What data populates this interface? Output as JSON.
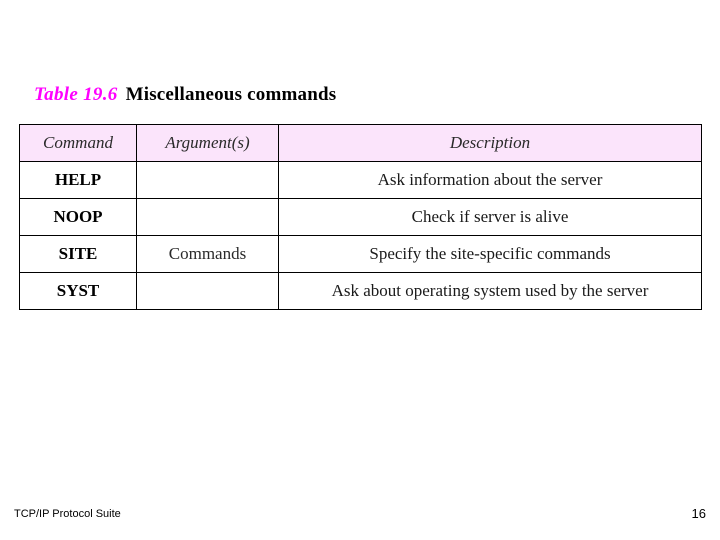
{
  "slide": {
    "title": {
      "label": "Table 19.6",
      "text": "Miscellaneous commands",
      "label_color": "#ff00ff"
    },
    "table": {
      "header_background": "#fbe4fb",
      "columns": [
        "Command",
        "Argument(s)",
        "Description"
      ],
      "rows": [
        {
          "command": "HELP",
          "argument": "",
          "description": "Ask information about the server"
        },
        {
          "command": "NOOP",
          "argument": "",
          "description": "Check if server is alive"
        },
        {
          "command": "SITE",
          "argument": "Commands",
          "description": "Specify the site-specific commands"
        },
        {
          "command": "SYST",
          "argument": "",
          "description": "Ask about operating system used by the server"
        }
      ]
    },
    "footer": {
      "left": "TCP/IP Protocol Suite",
      "page_number": "16"
    }
  }
}
